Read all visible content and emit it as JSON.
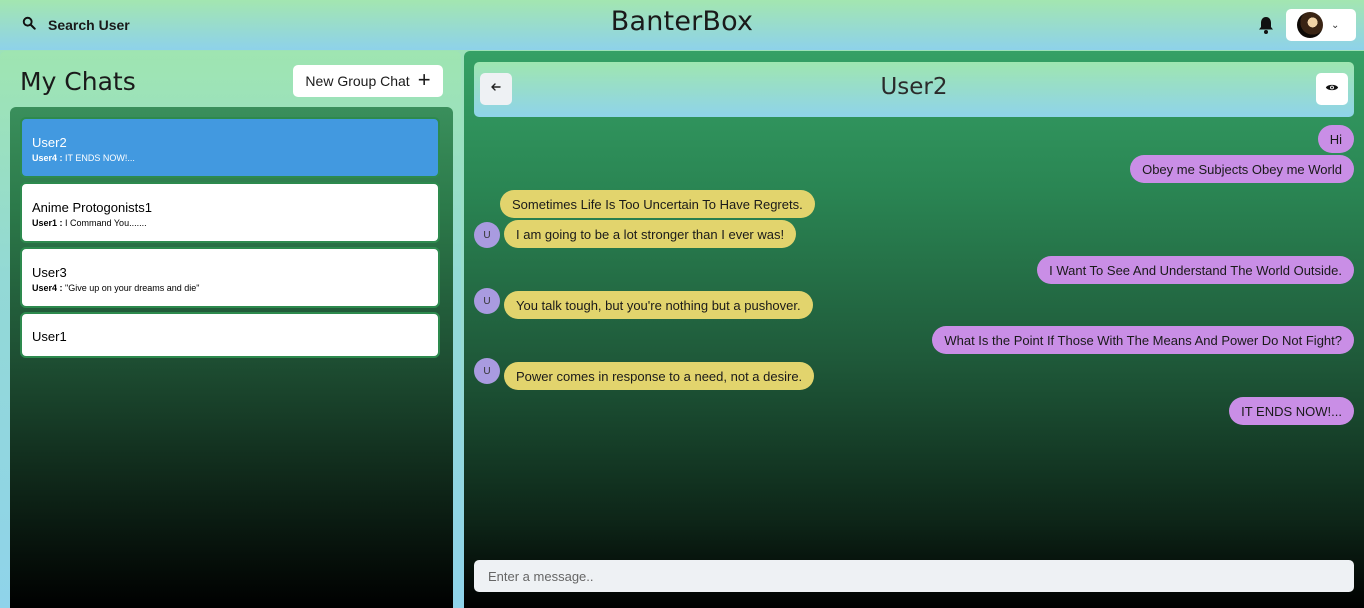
{
  "topbar": {
    "search_label": "Search User",
    "brand": "BanterBox",
    "icons": [
      "search-icon",
      "bell-icon",
      "chevron-down-icon"
    ]
  },
  "sidebar": {
    "title": "My Chats",
    "new_group_label": "New Group Chat",
    "chats": [
      {
        "name": "User2",
        "sender": "User4 :",
        "preview": "IT ENDS NOW!...",
        "active": true
      },
      {
        "name": "Anime Protogonists1",
        "sender": "User1 :",
        "preview": "I Command You......."
      },
      {
        "name": "User3",
        "sender": "User4 :",
        "preview": "\"Give up on your dreams and die\""
      },
      {
        "name": "User1"
      }
    ]
  },
  "chat": {
    "title": "User2",
    "avatar_initial": "U",
    "messages": [
      {
        "text": "Hi",
        "from": "me"
      },
      {
        "text": "Obey me Subjects Obey me World",
        "from": "me"
      },
      {
        "text": "Sometimes Life Is Too Uncertain To Have Regrets.",
        "from": "them"
      },
      {
        "text": "I am going to be a lot stronger than I ever was!",
        "from": "them"
      },
      {
        "text": "I Want To See And Understand The World Outside.",
        "from": "me"
      },
      {
        "text": "You talk tough, but you're nothing but a pushover.",
        "from": "them"
      },
      {
        "text": "What Is the Point If Those With The Means And Power Do Not Fight?",
        "from": "me"
      },
      {
        "text": "Power comes in response to a need, not a desire.",
        "from": "them"
      },
      {
        "text": "IT ENDS NOW!...",
        "from": "me"
      }
    ],
    "input_placeholder": "Enter a message.."
  },
  "colors": {
    "active_chat": "#4299e0",
    "my_bubble": "#c98ee6",
    "their_bubble": "#e2d46d",
    "avatar": "#a99be0"
  }
}
